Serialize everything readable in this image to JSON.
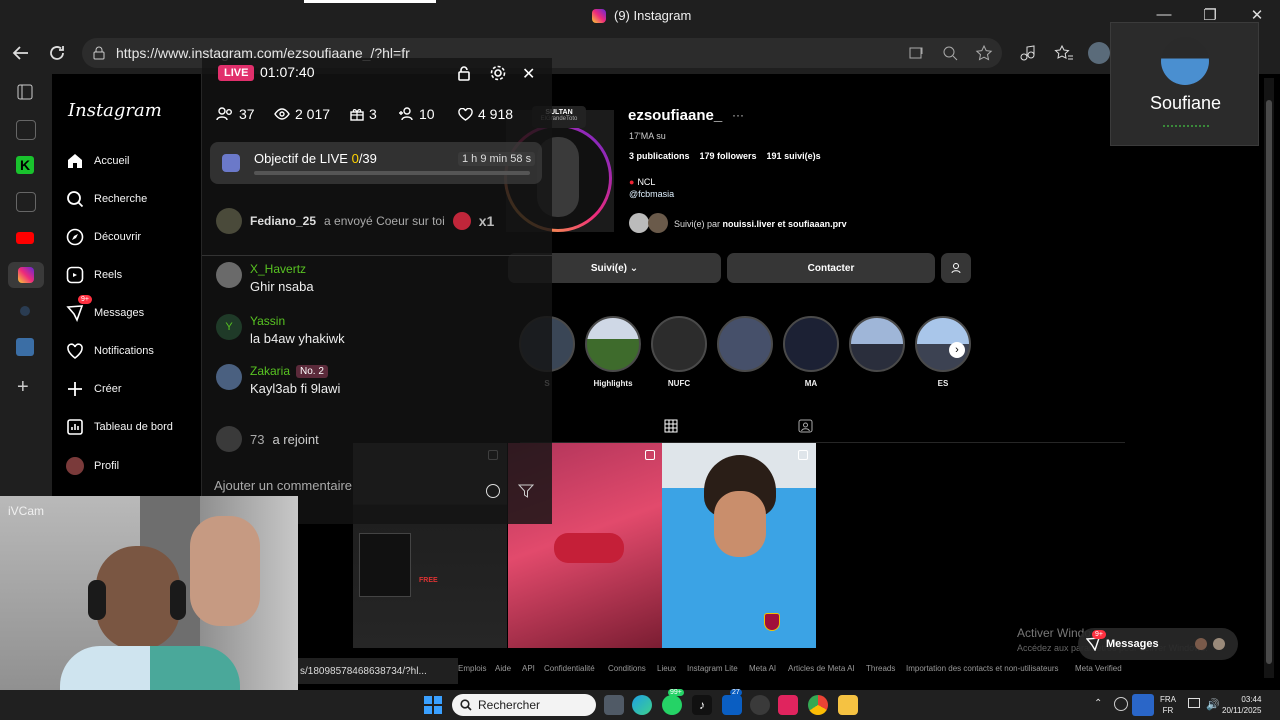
{
  "browser": {
    "tab_title": "(9) Instagram",
    "url": "https://www.instagram.com/ezsoufiaane_/?hl=fr",
    "status_url": "s/18098578468638734/?hl..."
  },
  "ig_nav": {
    "logo": "Instagram",
    "items": [
      {
        "label": "Accueil",
        "icon": "home-icon"
      },
      {
        "label": "Recherche",
        "icon": "search-icon"
      },
      {
        "label": "Découvrir",
        "icon": "compass-icon"
      },
      {
        "label": "Reels",
        "icon": "reels-icon"
      },
      {
        "label": "Messages",
        "icon": "messenger-icon",
        "badge": "9+"
      },
      {
        "label": "Notifications",
        "icon": "heart-icon"
      },
      {
        "label": "Créer",
        "icon": "plus-icon"
      },
      {
        "label": "Tableau de bord",
        "icon": "dashboard-icon"
      },
      {
        "label": "Profil",
        "icon": "avatar-icon"
      }
    ]
  },
  "live": {
    "badge": "LIVE",
    "time": "01:07:40",
    "stats": {
      "viewers": "37",
      "views": "2 017",
      "gifts": "3",
      "new_followers": "10",
      "likes": "4 918"
    },
    "goal_label": "Objectif de LIVE",
    "goal_value": "0",
    "goal_total": "/39",
    "goal_timer": "1 h 9 min 58 s",
    "goal_progress": 0,
    "gift_event": {
      "user": "Fediano_25",
      "text": "a envoyé Coeur sur toi",
      "count": "x1"
    },
    "comments": [
      {
        "user": "X_Havertz",
        "text": "Ghir nsaba",
        "tag": ""
      },
      {
        "user": "Yassin",
        "text": "la b4aw yhakiwk",
        "tag": ""
      },
      {
        "user": "Zakaria",
        "text": "Kayl3ab fi 9lawi",
        "tag": "No. 2"
      }
    ],
    "joined_count": "73",
    "joined_text": "a rejoint",
    "comment_placeholder": "Ajouter un commentaire"
  },
  "profile": {
    "username": "ezsoufiaane_",
    "ring_label": "SULTAN",
    "ring_sub": "ElGrandeToto",
    "sub": "17'MA su",
    "posts": "3 publications",
    "followers": "179 followers",
    "following": "191 suivi(e)s",
    "bio_line1": "NCL",
    "bio_line2": "@fcbmasia",
    "followed_by_prefix": "Suivi(e) par",
    "followed_by_names": "nouissi.liver et soufiaaan.prv",
    "btn_following": "Suivi(e)",
    "btn_contact": "Contacter",
    "highlights": [
      "S",
      "Highlights",
      "NUFC",
      "",
      "MA",
      "",
      "ES"
    ]
  },
  "footer_links": [
    "Emplois",
    "Aide",
    "API",
    "Confidentialité",
    "Conditions",
    "Lieux",
    "Instagram Lite",
    "Meta AI",
    "Articles de Meta AI",
    "Threads",
    "Importation des contacts et non-utilisateurs",
    "Meta Verified"
  ],
  "messages_pill": {
    "label": "Messages",
    "badge": "9+"
  },
  "windows_watermark": {
    "line1": "Activer Windows",
    "line2": "Accédez aux paramètres pour activer Windows."
  },
  "webcam_label": "iVCam",
  "profile_card": {
    "name": "Soufiane"
  },
  "taskbar": {
    "search": "Rechercher",
    "lang1": "FRA",
    "lang2": "FR",
    "time": "03:44",
    "date": "20/11/2025",
    "badge_whatsapp": "99+",
    "badge_edge": "27"
  },
  "colors": {
    "accent": "#e1306c",
    "username_green": "#58c322",
    "progress_bg": "#555555"
  }
}
